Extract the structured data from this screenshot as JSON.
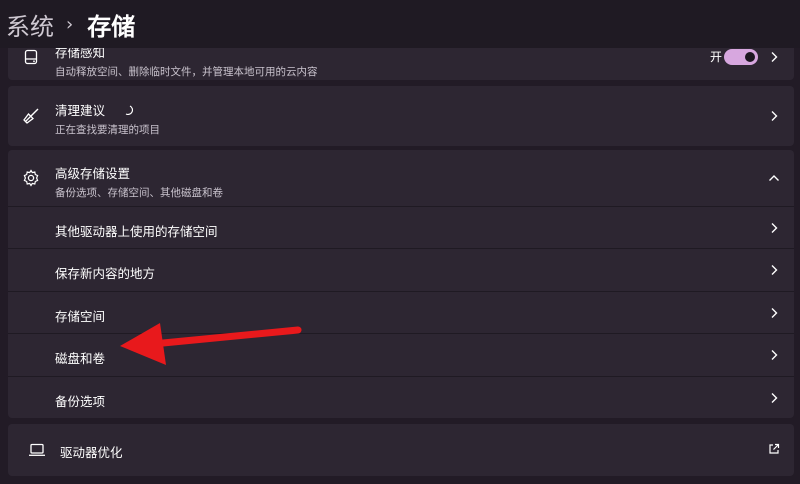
{
  "breadcrumb": {
    "root": "系统",
    "current": "存储"
  },
  "storage_sense": {
    "title": "存储感知",
    "subtitle": "自动释放空间、删除临时文件，并管理本地可用的云内容",
    "toggle_label": "开",
    "toggle_on": true,
    "icon": "drive-icon"
  },
  "cleanup": {
    "title": "清理建议",
    "subtitle": "正在查找要清理的项目",
    "icon": "broom-icon"
  },
  "advanced": {
    "title": "高级存储设置",
    "subtitle": "备份选项、存储空间、其他磁盘和卷",
    "icon": "gear-icon",
    "items": [
      {
        "label": "其他驱动器上使用的存储空间"
      },
      {
        "label": "保存新内容的地方"
      },
      {
        "label": "存储空间"
      },
      {
        "label": "磁盘和卷"
      },
      {
        "label": "备份选项"
      }
    ]
  },
  "optimize": {
    "title": "驱动器优化",
    "icon": "laptop-icon",
    "action_icon": "open-external-icon"
  },
  "colors": {
    "background": "#221b26",
    "card": "#2d2632",
    "accent_toggle": "#d7a7df",
    "annotation_arrow": "#e8191c"
  }
}
